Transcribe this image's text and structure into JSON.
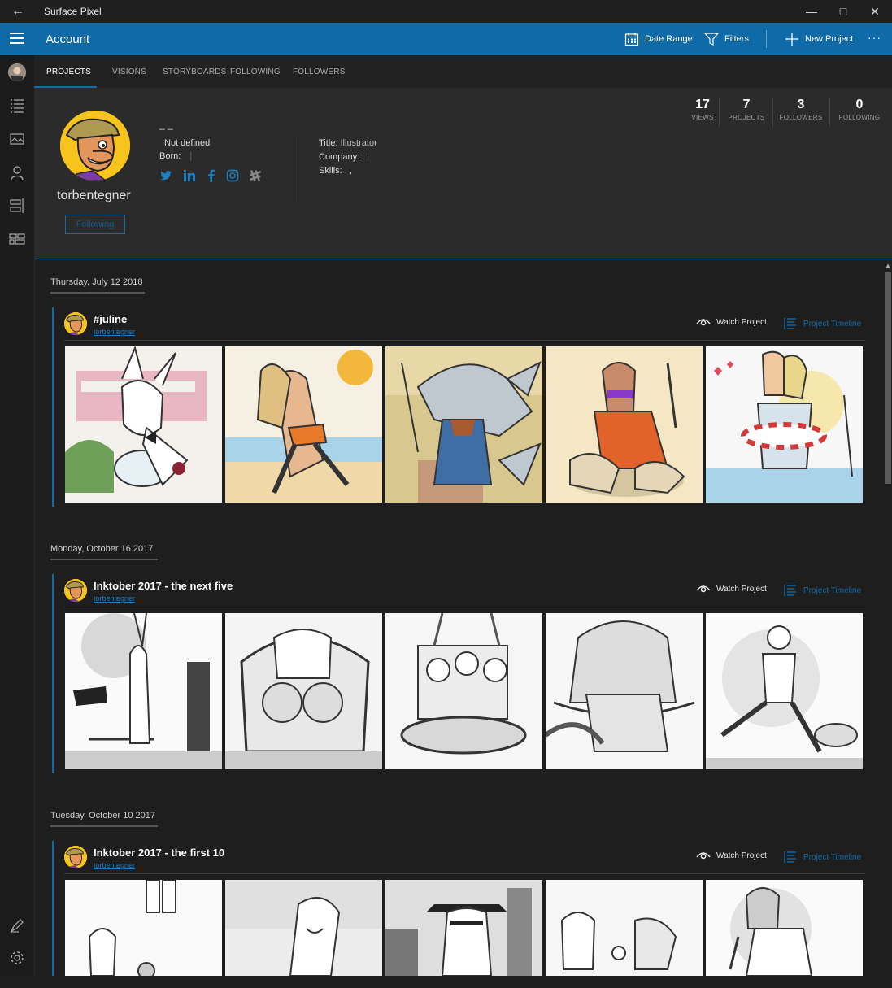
{
  "window": {
    "title": "Surface Pixel"
  },
  "appbar": {
    "title": "Account",
    "date_range": "Date Range",
    "filters": "Filters",
    "new_project": "New Project",
    "more": "···"
  },
  "tabs": [
    "PROJECTS",
    "VISIONS",
    "STORYBOARDS",
    "FOLLOWING",
    "FOLLOWERS"
  ],
  "profile": {
    "name_placeholder": "_ _",
    "location": "Not defined",
    "born_label": "Born:",
    "username": "torbentegner",
    "follow_button": "Following",
    "title_label": "Title:",
    "title_value": "Illustrator",
    "company_label": "Company:",
    "skills_label": "Skills:",
    "skills_value": ",  ,",
    "social_icons": [
      "twitter-icon",
      "linkedin-icon",
      "facebook-icon",
      "instagram-icon",
      "slack-icon"
    ],
    "stats": [
      {
        "value": "17",
        "label": "VIEWS"
      },
      {
        "value": "7",
        "label": "PROJECTS"
      },
      {
        "value": "3",
        "label": "FOLLOWERS"
      },
      {
        "value": "0",
        "label": "FOLLOWING"
      }
    ]
  },
  "feed": [
    {
      "date": "Thursday, July 12 2018",
      "title": "#juline",
      "user": "torbentegner",
      "watch": "Watch Project",
      "timeline": "Project Timeline"
    },
    {
      "date": "Monday, October 16 2017",
      "title": "Inktober 2017 - the next five",
      "user": "torbentegner",
      "watch": "Watch Project",
      "timeline": "Project Timeline"
    },
    {
      "date": "Tuesday, October 10 2017",
      "title": "Inktober 2017 - the first 10",
      "user": "torbentegner",
      "watch": "Watch Project",
      "timeline": "Project Timeline"
    }
  ],
  "colors": {
    "accent": "#0f6aa8",
    "avatar_bg": "#f7c41d"
  }
}
